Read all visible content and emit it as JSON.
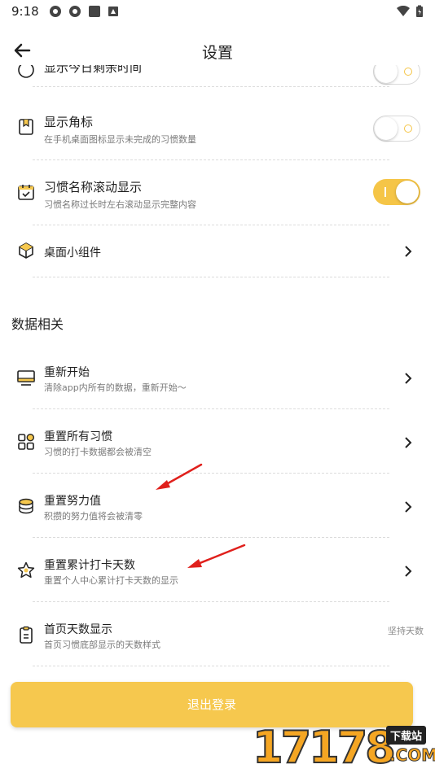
{
  "status_bar": {
    "time": "9:18"
  },
  "header": {
    "title": "设置"
  },
  "partial_row": {
    "title": "显示今日剩余时间"
  },
  "rows_top": [
    {
      "title": "显示角标",
      "subtitle": "在手机桌面图标显示未完成的习惯数量",
      "toggle": "off"
    },
    {
      "title": "习惯名称滚动显示",
      "subtitle": "习惯名称过长时左右滚动显示完整内容",
      "toggle": "on"
    },
    {
      "title": "桌面小组件"
    }
  ],
  "section": {
    "title": "数据相关"
  },
  "rows_data": [
    {
      "title": "重新开始",
      "subtitle": "清除app内所有的数据，重新开始～"
    },
    {
      "title": "重置所有习惯",
      "subtitle": "习惯的打卡数据都会被清空"
    },
    {
      "title": "重置努力值",
      "subtitle": "积攒的努力值将会被清零"
    },
    {
      "title": "重置累计打卡天数",
      "subtitle": "重置个人中心累计打卡天数的显示"
    },
    {
      "title": "首页天数显示",
      "subtitle": "首页习惯底部显示的天数样式",
      "value": "坚持天数"
    }
  ],
  "logout": {
    "label": "退出登录"
  },
  "watermark": {
    "digits": "17178",
    "box": "下载站",
    "com": ".COM"
  },
  "colors": {
    "accent": "#f6c84e",
    "annotation_arrow": "#e0201c"
  }
}
